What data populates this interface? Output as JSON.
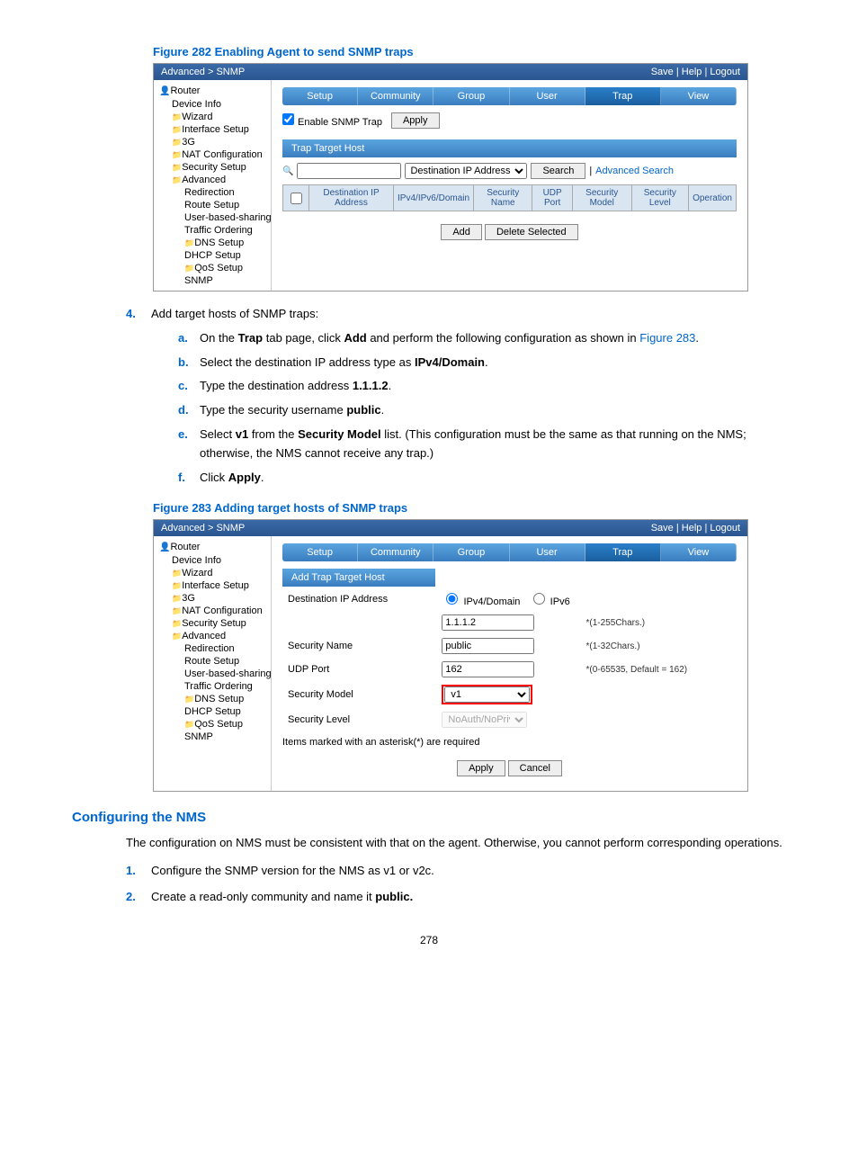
{
  "figure282": {
    "title": "Figure 282 Enabling Agent to send SNMP traps",
    "breadcrumb": "Advanced > SNMP",
    "header_links": "Save | Help | Logout",
    "router_label": "Router",
    "sidebar": [
      "Device Info",
      "Wizard",
      "Interface Setup",
      "3G",
      "NAT Configuration",
      "Security Setup",
      "Advanced"
    ],
    "sidebar_sub": [
      "Redirection",
      "Route Setup",
      "User-based-sharing",
      "Traffic Ordering",
      "DNS Setup",
      "DHCP Setup",
      "QoS Setup",
      "SNMP"
    ],
    "tabs": [
      "Setup",
      "Community",
      "Group",
      "User",
      "Trap",
      "View"
    ],
    "enable_label": "Enable SNMP Trap",
    "apply_btn": "Apply",
    "panel_title": "Trap Target Host",
    "search_select": "Destination IP Address",
    "search_btn": "Search",
    "adv_search": "Advanced Search",
    "table_headers": [
      "",
      "Destination IP Address",
      "IPv4/IPv6/Domain",
      "Security Name",
      "UDP Port",
      "Security Model",
      "Security Level",
      "Operation"
    ],
    "add_btn": "Add",
    "delete_btn": "Delete Selected"
  },
  "step4": {
    "num": "4.",
    "text": "Add target hosts of SNMP traps:",
    "a": {
      "l": "a.",
      "t1": "On the ",
      "b1": "Trap",
      "t2": " tab page, click ",
      "b2": "Add",
      "t3": " and perform the following configuration as shown in ",
      "link": "Figure 283",
      "t4": "."
    },
    "b": {
      "l": "b.",
      "t1": "Select the destination IP address type as ",
      "b1": "IPv4/Domain",
      "t2": "."
    },
    "c": {
      "l": "c.",
      "t1": "Type the destination address ",
      "b1": "1.1.1.2",
      "t2": "."
    },
    "d": {
      "l": "d.",
      "t1": "Type the security username ",
      "b1": "public",
      "t2": "."
    },
    "e": {
      "l": "e.",
      "t1": "Select ",
      "b1": "v1",
      "t2": " from the ",
      "b2": "Security Model",
      "t3": " list. (This configuration must be the same as that running on the NMS; otherwise, the NMS cannot receive any trap.)"
    },
    "f": {
      "l": "f.",
      "t1": "Click ",
      "b1": "Apply",
      "t2": "."
    }
  },
  "figure283": {
    "title": "Figure 283 Adding target hosts of SNMP traps",
    "breadcrumb": "Advanced > SNMP",
    "header_links": "Save | Help | Logout",
    "router_label": "Router",
    "sidebar": [
      "Device Info",
      "Wizard",
      "Interface Setup",
      "3G",
      "NAT Configuration",
      "Security Setup",
      "Advanced"
    ],
    "sidebar_sub": [
      "Redirection",
      "Route Setup",
      "User-based-sharing",
      "Traffic Ordering",
      "DNS Setup",
      "DHCP Setup",
      "QoS Setup",
      "SNMP"
    ],
    "tabs": [
      "Setup",
      "Community",
      "Group",
      "User",
      "Trap",
      "View"
    ],
    "panel_title": "Add Trap Target Host",
    "row_dest": "Destination IP Address",
    "radio1": "IPv4/Domain",
    "radio2": "IPv6",
    "ip_value": "1.1.1.2",
    "ip_hint": "*(1-255Chars.)",
    "row_secname": "Security Name",
    "secname_value": "public",
    "secname_hint": "*(1-32Chars.)",
    "row_udp": "UDP Port",
    "udp_value": "162",
    "udp_hint": "*(0-65535, Default = 162)",
    "row_model": "Security Model",
    "model_value": "v1",
    "row_level": "Security Level",
    "level_value": "NoAuth/NoPriv",
    "required_note": "Items marked with an asterisk(*) are required",
    "apply_btn": "Apply",
    "cancel_btn": "Cancel"
  },
  "nms": {
    "title": "Configuring the NMS",
    "intro": "The configuration on NMS must be consistent with that on the agent. Otherwise, you cannot perform corresponding operations.",
    "s1": {
      "n": "1.",
      "t": "Configure the SNMP version for the NMS as v1 or v2c."
    },
    "s2": {
      "n": "2.",
      "t1": "Create a read-only community and name it ",
      "b": "public."
    }
  },
  "page_number": "278"
}
